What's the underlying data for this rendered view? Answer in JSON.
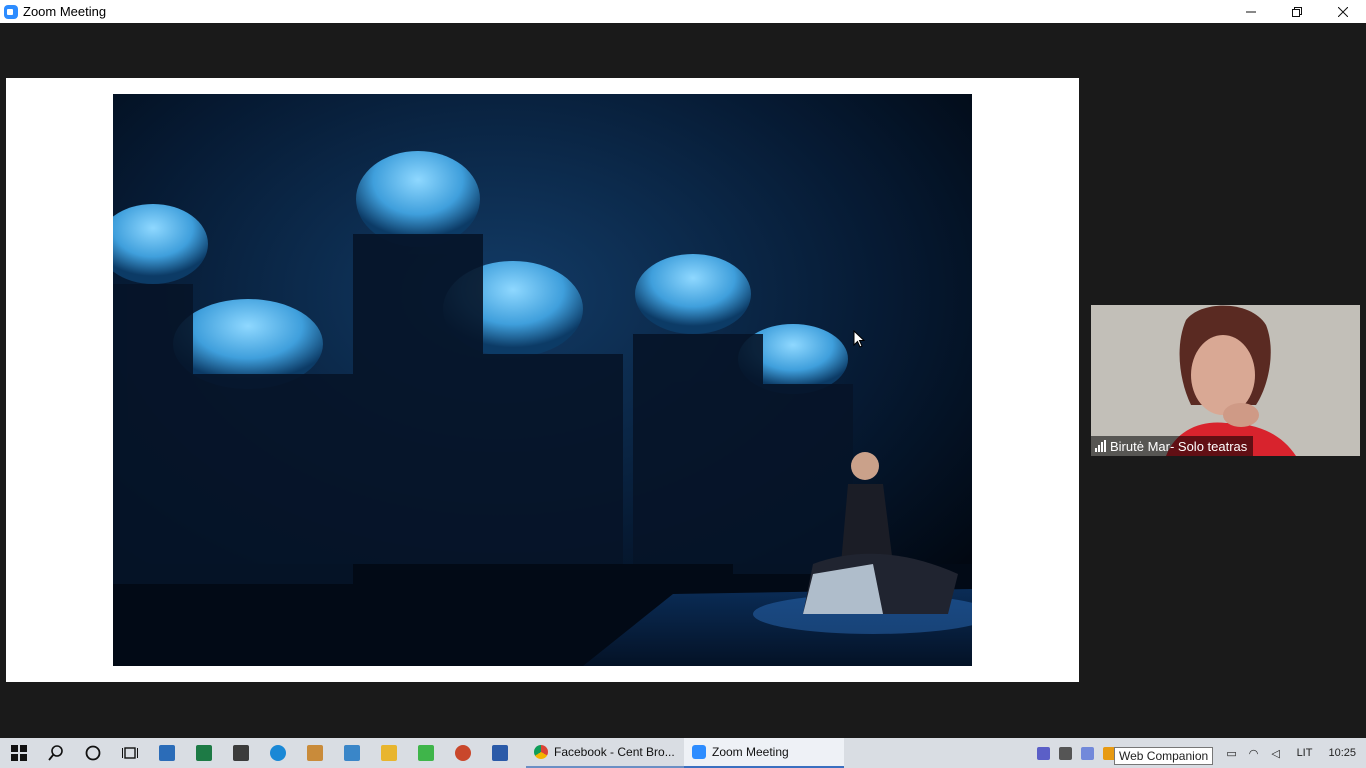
{
  "window": {
    "title": "Zoom Meeting",
    "controls": [
      "minimize-icon",
      "restore-icon",
      "close-icon"
    ]
  },
  "meeting": {
    "shared_content": "slide-photo",
    "next_arrow_icon": "chevron-right-icon",
    "participant": {
      "name": "Birutė Mar- Solo teatras",
      "signal_icon": "signal-strength-icon"
    }
  },
  "taskbar": {
    "pinned": [
      {
        "name": "start",
        "icon": "windows-logo-icon"
      },
      {
        "name": "search",
        "icon": "search-icon"
      },
      {
        "name": "cortana",
        "icon": "circle-icon"
      },
      {
        "name": "task-view",
        "icon": "task-view-icon"
      },
      {
        "name": "calculator",
        "icon": "calculator-icon",
        "color": "#2b6cb8"
      },
      {
        "name": "excel",
        "icon": "excel-icon",
        "color": "#1d7a45"
      },
      {
        "name": "app-shield",
        "icon": "shield-icon",
        "color": "#3b3b3b"
      },
      {
        "name": "edge",
        "icon": "edge-icon",
        "color": "#1a88d6"
      },
      {
        "name": "paint",
        "icon": "paint-icon",
        "color": "#c98b3a"
      },
      {
        "name": "control-panel",
        "icon": "control-panel-icon",
        "color": "#3a86c8"
      },
      {
        "name": "file-explorer",
        "icon": "folder-icon",
        "color": "#e8b52e"
      },
      {
        "name": "green-app",
        "icon": "green-app-icon",
        "color": "#3fb54a"
      },
      {
        "name": "powerpoint",
        "icon": "powerpoint-icon",
        "color": "#c9472b"
      },
      {
        "name": "word",
        "icon": "word-icon",
        "color": "#2a5aa8"
      }
    ],
    "tasks": [
      {
        "label": "Facebook - Cent Bro...",
        "icon": "chrome-icon",
        "active": false
      },
      {
        "label": "Zoom Meeting",
        "icon": "zoom-icon",
        "active": true
      }
    ],
    "tray": {
      "language": "LIT",
      "time": "10:25",
      "tooltip": "Web Companion"
    }
  }
}
